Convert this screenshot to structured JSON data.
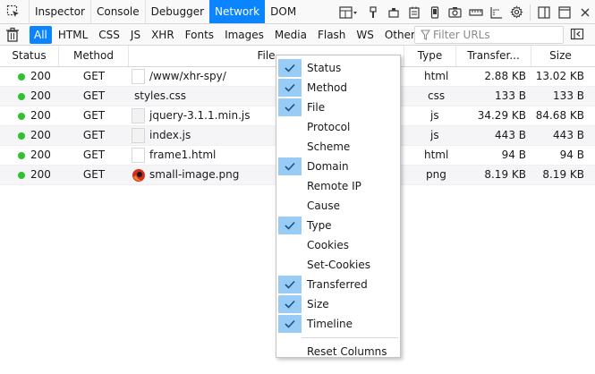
{
  "devtools": {
    "tabs": [
      {
        "label": "Inspector"
      },
      {
        "label": "Console"
      },
      {
        "label": "Debugger"
      },
      {
        "label": "Network",
        "selected": true
      },
      {
        "label": "DOM"
      }
    ]
  },
  "filters": {
    "buttons": [
      "All",
      "HTML",
      "CSS",
      "JS",
      "XHR",
      "Fonts",
      "Images",
      "Media",
      "Flash",
      "WS",
      "Other"
    ],
    "active": "All",
    "search_placeholder": "Filter URLs"
  },
  "table": {
    "columns": {
      "status": "Status",
      "method": "Method",
      "file": "File",
      "type": "Type",
      "transferred": "Transfer...",
      "size": "Size"
    },
    "rows": [
      {
        "status": "200",
        "method": "GET",
        "file": "/www/xhr-spy/",
        "type": "html",
        "transferred": "2.88 KB",
        "size": "13.02 KB"
      },
      {
        "status": "200",
        "method": "GET",
        "file": "styles.css",
        "type": "css",
        "transferred": "133 B",
        "size": "133 B"
      },
      {
        "status": "200",
        "method": "GET",
        "file": "jquery-3.1.1.min.js",
        "type": "js",
        "transferred": "34.29 KB",
        "size": "84.68 KB"
      },
      {
        "status": "200",
        "method": "GET",
        "file": "index.js",
        "type": "js",
        "transferred": "443 B",
        "size": "443 B"
      },
      {
        "status": "200",
        "method": "GET",
        "file": "frame1.html",
        "type": "html",
        "transferred": "94 B",
        "size": "94 B"
      },
      {
        "status": "200",
        "method": "GET",
        "file": "small-image.png",
        "type": "png",
        "transferred": "8.19 KB",
        "size": "8.19 KB"
      }
    ]
  },
  "context_menu": {
    "items": [
      {
        "label": "Status",
        "checked": true
      },
      {
        "label": "Method",
        "checked": true
      },
      {
        "label": "File",
        "checked": true
      },
      {
        "label": "Protocol",
        "checked": false
      },
      {
        "label": "Scheme",
        "checked": false
      },
      {
        "label": "Domain",
        "checked": true
      },
      {
        "label": "Remote IP",
        "checked": false
      },
      {
        "label": "Cause",
        "checked": false
      },
      {
        "label": "Type",
        "checked": true
      },
      {
        "label": "Cookies",
        "checked": false
      },
      {
        "label": "Set-Cookies",
        "checked": false
      },
      {
        "label": "Transferred",
        "checked": true
      },
      {
        "label": "Size",
        "checked": true
      },
      {
        "label": "Timeline",
        "checked": true
      }
    ],
    "reset_label": "Reset Columns"
  },
  "colors": {
    "accent": "#0a84ff",
    "check_bg": "#99ccf5",
    "status_ok": "#30c030"
  }
}
